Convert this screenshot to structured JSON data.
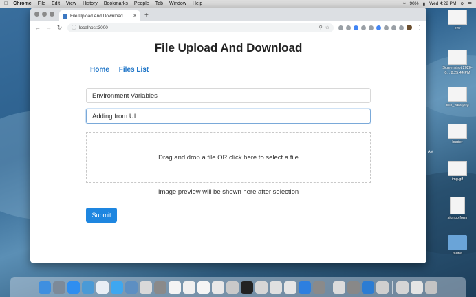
{
  "menubar": {
    "app_name": "Chrome",
    "menus": [
      "File",
      "Edit",
      "View",
      "History",
      "Bookmarks",
      "People",
      "Tab",
      "Window",
      "Help"
    ],
    "battery": "90%",
    "clock": "Wed 4:22 PM"
  },
  "browser": {
    "tab_title": "File Upload And Download",
    "url": "localhost:3000"
  },
  "page": {
    "title": "File Upload And Download",
    "nav": {
      "home": "Home",
      "files_list": "Files List"
    },
    "title_field_value": "Environment Variables",
    "description_field_value": "Adding from UI",
    "dropzone_text": "Drag and drop a file OR click here to select a file",
    "preview_message": "Image preview will be shown here after selection",
    "submit_label": "Submit"
  },
  "desktop": {
    "icons": [
      {
        "label": "env"
      },
      {
        "label": "Screenshot 2020-0... 8.25.44 PM"
      },
      {
        "label": "env_vars.png"
      },
      {
        "label": "loader"
      },
      {
        "label": "img.gif"
      },
      {
        "label": "signup form"
      },
      {
        "label": "fauna"
      }
    ],
    "side_text": "AM"
  },
  "colors": {
    "accent": "#1e86e0",
    "nav_link": "#1e75c8"
  }
}
